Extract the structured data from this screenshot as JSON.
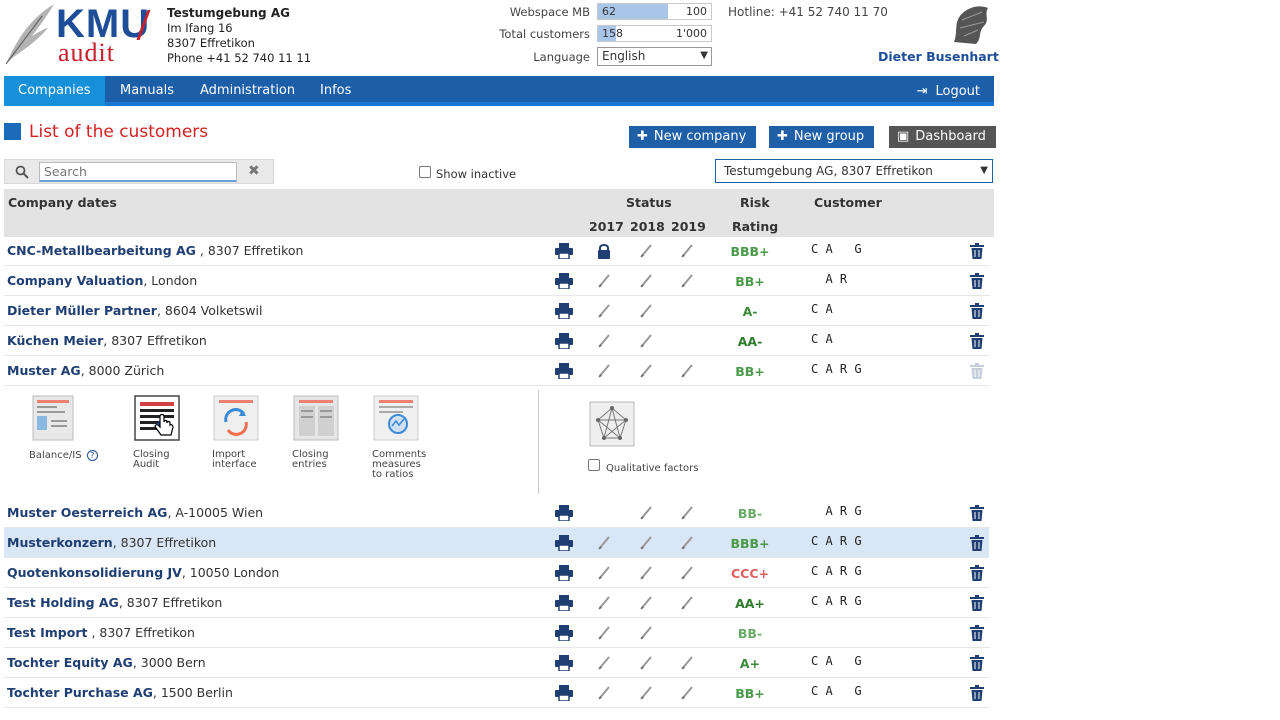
{
  "header": {
    "logo_top": "KMU",
    "logo_bottom": "audit",
    "company_name": "Testumgebung AG",
    "street": "Im Ifang 16",
    "city": "8307 Effretikon",
    "phone": "Phone +41 52 740 11 11",
    "webspace_label": "Webspace MB",
    "webspace_used": "62",
    "webspace_total": "100",
    "webspace_fraction": 0.62,
    "customers_label": "Total customers",
    "customers_used": "158",
    "customers_total": "1'000",
    "customers_fraction": 0.158,
    "language_label": "Language",
    "language_value": "English",
    "hotline": "Hotline: +41 52 740 11 70",
    "user_name": "Dieter Busenhart"
  },
  "nav": {
    "items": [
      "Companies",
      "Manuals",
      "Administration",
      "Infos"
    ],
    "active": "Companies",
    "logout": "Logout"
  },
  "page": {
    "title": "List of the customers",
    "new_company": "New company",
    "new_group": "New group",
    "dashboard": "Dashboard",
    "search_placeholder": "Search",
    "show_inactive": "Show inactive",
    "company_filter": "Testumgebung AG, 8307 Effretikon"
  },
  "table": {
    "col_company": "Company dates",
    "col_status": "Status",
    "years": [
      "2017",
      "2018",
      "2019"
    ],
    "col_risk": "Risk",
    "col_rating": "Rating",
    "col_customer": "Customer",
    "rows": [
      {
        "name": "CNC-Metallbearbeitung AG",
        "loc": " , 8307 Effretikon",
        "status": [
          "lock",
          "pen",
          "pen"
        ],
        "risk": "BBB+",
        "risk_color": "#4a9a4a",
        "cust": "C A   G"
      },
      {
        "name": "Company Valuation",
        "loc": ", London",
        "status": [
          "pen",
          "pen",
          "pen"
        ],
        "risk": "BB+",
        "risk_color": "#4a9a4a",
        "cust": "  A R"
      },
      {
        "name": "Dieter Müller Partner",
        "loc": ", 8604 Volketswil",
        "status": [
          "pen",
          "pen",
          ""
        ],
        "risk": "A-",
        "risk_color": "#3a8a3a",
        "cust": "C A"
      },
      {
        "name": "Küchen Meier",
        "loc": ", 8307 Effretikon",
        "status": [
          "pen",
          "pen",
          ""
        ],
        "risk": "AA-",
        "risk_color": "#2e7d2e",
        "cust": "C A"
      },
      {
        "name": "Muster AG",
        "loc": ", 8000 Zürich",
        "status": [
          "pen",
          "pen",
          "pen"
        ],
        "risk": "BB+",
        "risk_color": "#4a9a4a",
        "cust": "C A R G"
      },
      {
        "name": "Muster Oesterreich AG",
        "loc": ", A-10005 Wien",
        "status": [
          "",
          "pen",
          "pen"
        ],
        "risk": "BB-",
        "risk_color": "#6aaa6a",
        "cust": "  A R G"
      },
      {
        "name": "Musterkonzern",
        "loc": ", 8307 Effretikon",
        "status": [
          "pen",
          "pen",
          "pen"
        ],
        "risk": "BBB+",
        "risk_color": "#4a9a4a",
        "cust": "C A R G"
      },
      {
        "name": "Quotenkonsolidierung JV",
        "loc": ", 10050 London",
        "status": [
          "pen",
          "pen",
          "pen"
        ],
        "risk": "CCC+",
        "risk_color": "#e06060",
        "cust": "C A R G"
      },
      {
        "name": "Test Holding AG",
        "loc": ", 8307 Effretikon",
        "status": [
          "pen",
          "pen",
          "pen"
        ],
        "risk": "AA+",
        "risk_color": "#2e7d2e",
        "cust": "C A R G"
      },
      {
        "name": "Test Import",
        "loc": " , 8307 Effretikon",
        "status": [
          "pen",
          "pen",
          ""
        ],
        "risk": "BB-",
        "risk_color": "#6aaa6a",
        "cust": ""
      },
      {
        "name": "Tochter Equity AG",
        "loc": ", 3000 Bern",
        "status": [
          "pen",
          "pen",
          "pen"
        ],
        "risk": "A+",
        "risk_color": "#3a8a3a",
        "cust": "C A   G"
      },
      {
        "name": "Tochter Purchase AG",
        "loc": ", 1500 Berlin",
        "status": [
          "pen",
          "pen",
          "pen"
        ],
        "risk": "BB+",
        "risk_color": "#4a9a4a",
        "cust": "C A   G"
      }
    ]
  },
  "panel": {
    "tools": [
      {
        "label1": "Balance/IS",
        "label2": "",
        "label3": ""
      },
      {
        "label1": "Closing",
        "label2": "Audit",
        "label3": ""
      },
      {
        "label1": "Import",
        "label2": "interface",
        "label3": ""
      },
      {
        "label1": "Closing",
        "label2": "entries",
        "label3": ""
      },
      {
        "label1": "Comments",
        "label2": "measures",
        "label3": "to ratios"
      }
    ],
    "qualitative": "Qualitative factors"
  }
}
